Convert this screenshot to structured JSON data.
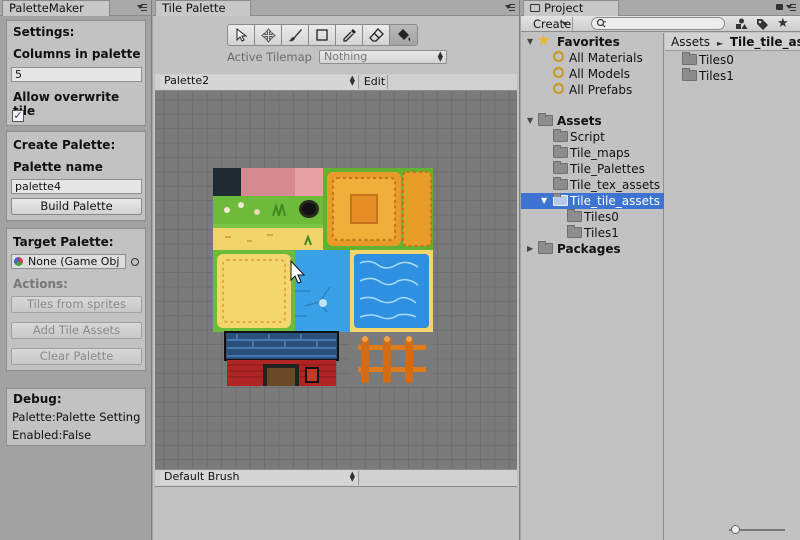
{
  "palette_maker": {
    "tab": "PaletteMaker",
    "settings_title": "Settings:",
    "columns_label": "Columns in palette",
    "columns_value": "5",
    "overwrite_label": "Allow overwrite tile",
    "overwrite_checked": "✓",
    "create_title": "Create Palette:",
    "name_label": "Palette name",
    "name_value": "palette4",
    "build_button": "Build Palette",
    "target_title": "Target Palette:",
    "target_value": "None (Game Obj",
    "actions_label": "Actions:",
    "tiles_from_sprites": "Tiles from sprites",
    "add_tile_assets": "Add Tile Assets",
    "clear_palette": "Clear Palette",
    "debug_title": "Debug:",
    "debug_line1": "Palette:Palette Setting",
    "debug_line2": "Enabled:False"
  },
  "tile_palette": {
    "tab": "Tile Palette",
    "active_tilemap_label": "Active Tilemap",
    "active_tilemap_value": "Nothing",
    "palette_select": "Palette2",
    "edit_button": "Edit",
    "brush_select": "Default Brush",
    "tools": [
      "select-arrow-icon",
      "move-icon",
      "paint-brush-icon",
      "box-fill-icon",
      "picker-icon",
      "eraser-icon",
      "fill-bucket-icon"
    ]
  },
  "project": {
    "tab": "Project",
    "create_button": "Create",
    "search_placeholder": "",
    "favorites": "Favorites",
    "fav_items": [
      "All Materials",
      "All Models",
      "All Prefabs"
    ],
    "assets": "Assets",
    "asset_folders": [
      "Script",
      "Tile_maps",
      "Tile_Palettes",
      "Tile_tex_assets",
      "Tile_tile_assets"
    ],
    "sub_folders": [
      "Tiles0",
      "Tiles1"
    ],
    "packages": "Packages",
    "breadcrumb_root": "Assets",
    "breadcrumb_sep": "►",
    "breadcrumb_current": "Tile_tile_assets",
    "content_items": [
      "Tiles0",
      "Tiles1"
    ]
  },
  "colors": {
    "selection": "#3d74d1",
    "panel": "#c2c2c2",
    "grid": "#7a7a7a"
  }
}
